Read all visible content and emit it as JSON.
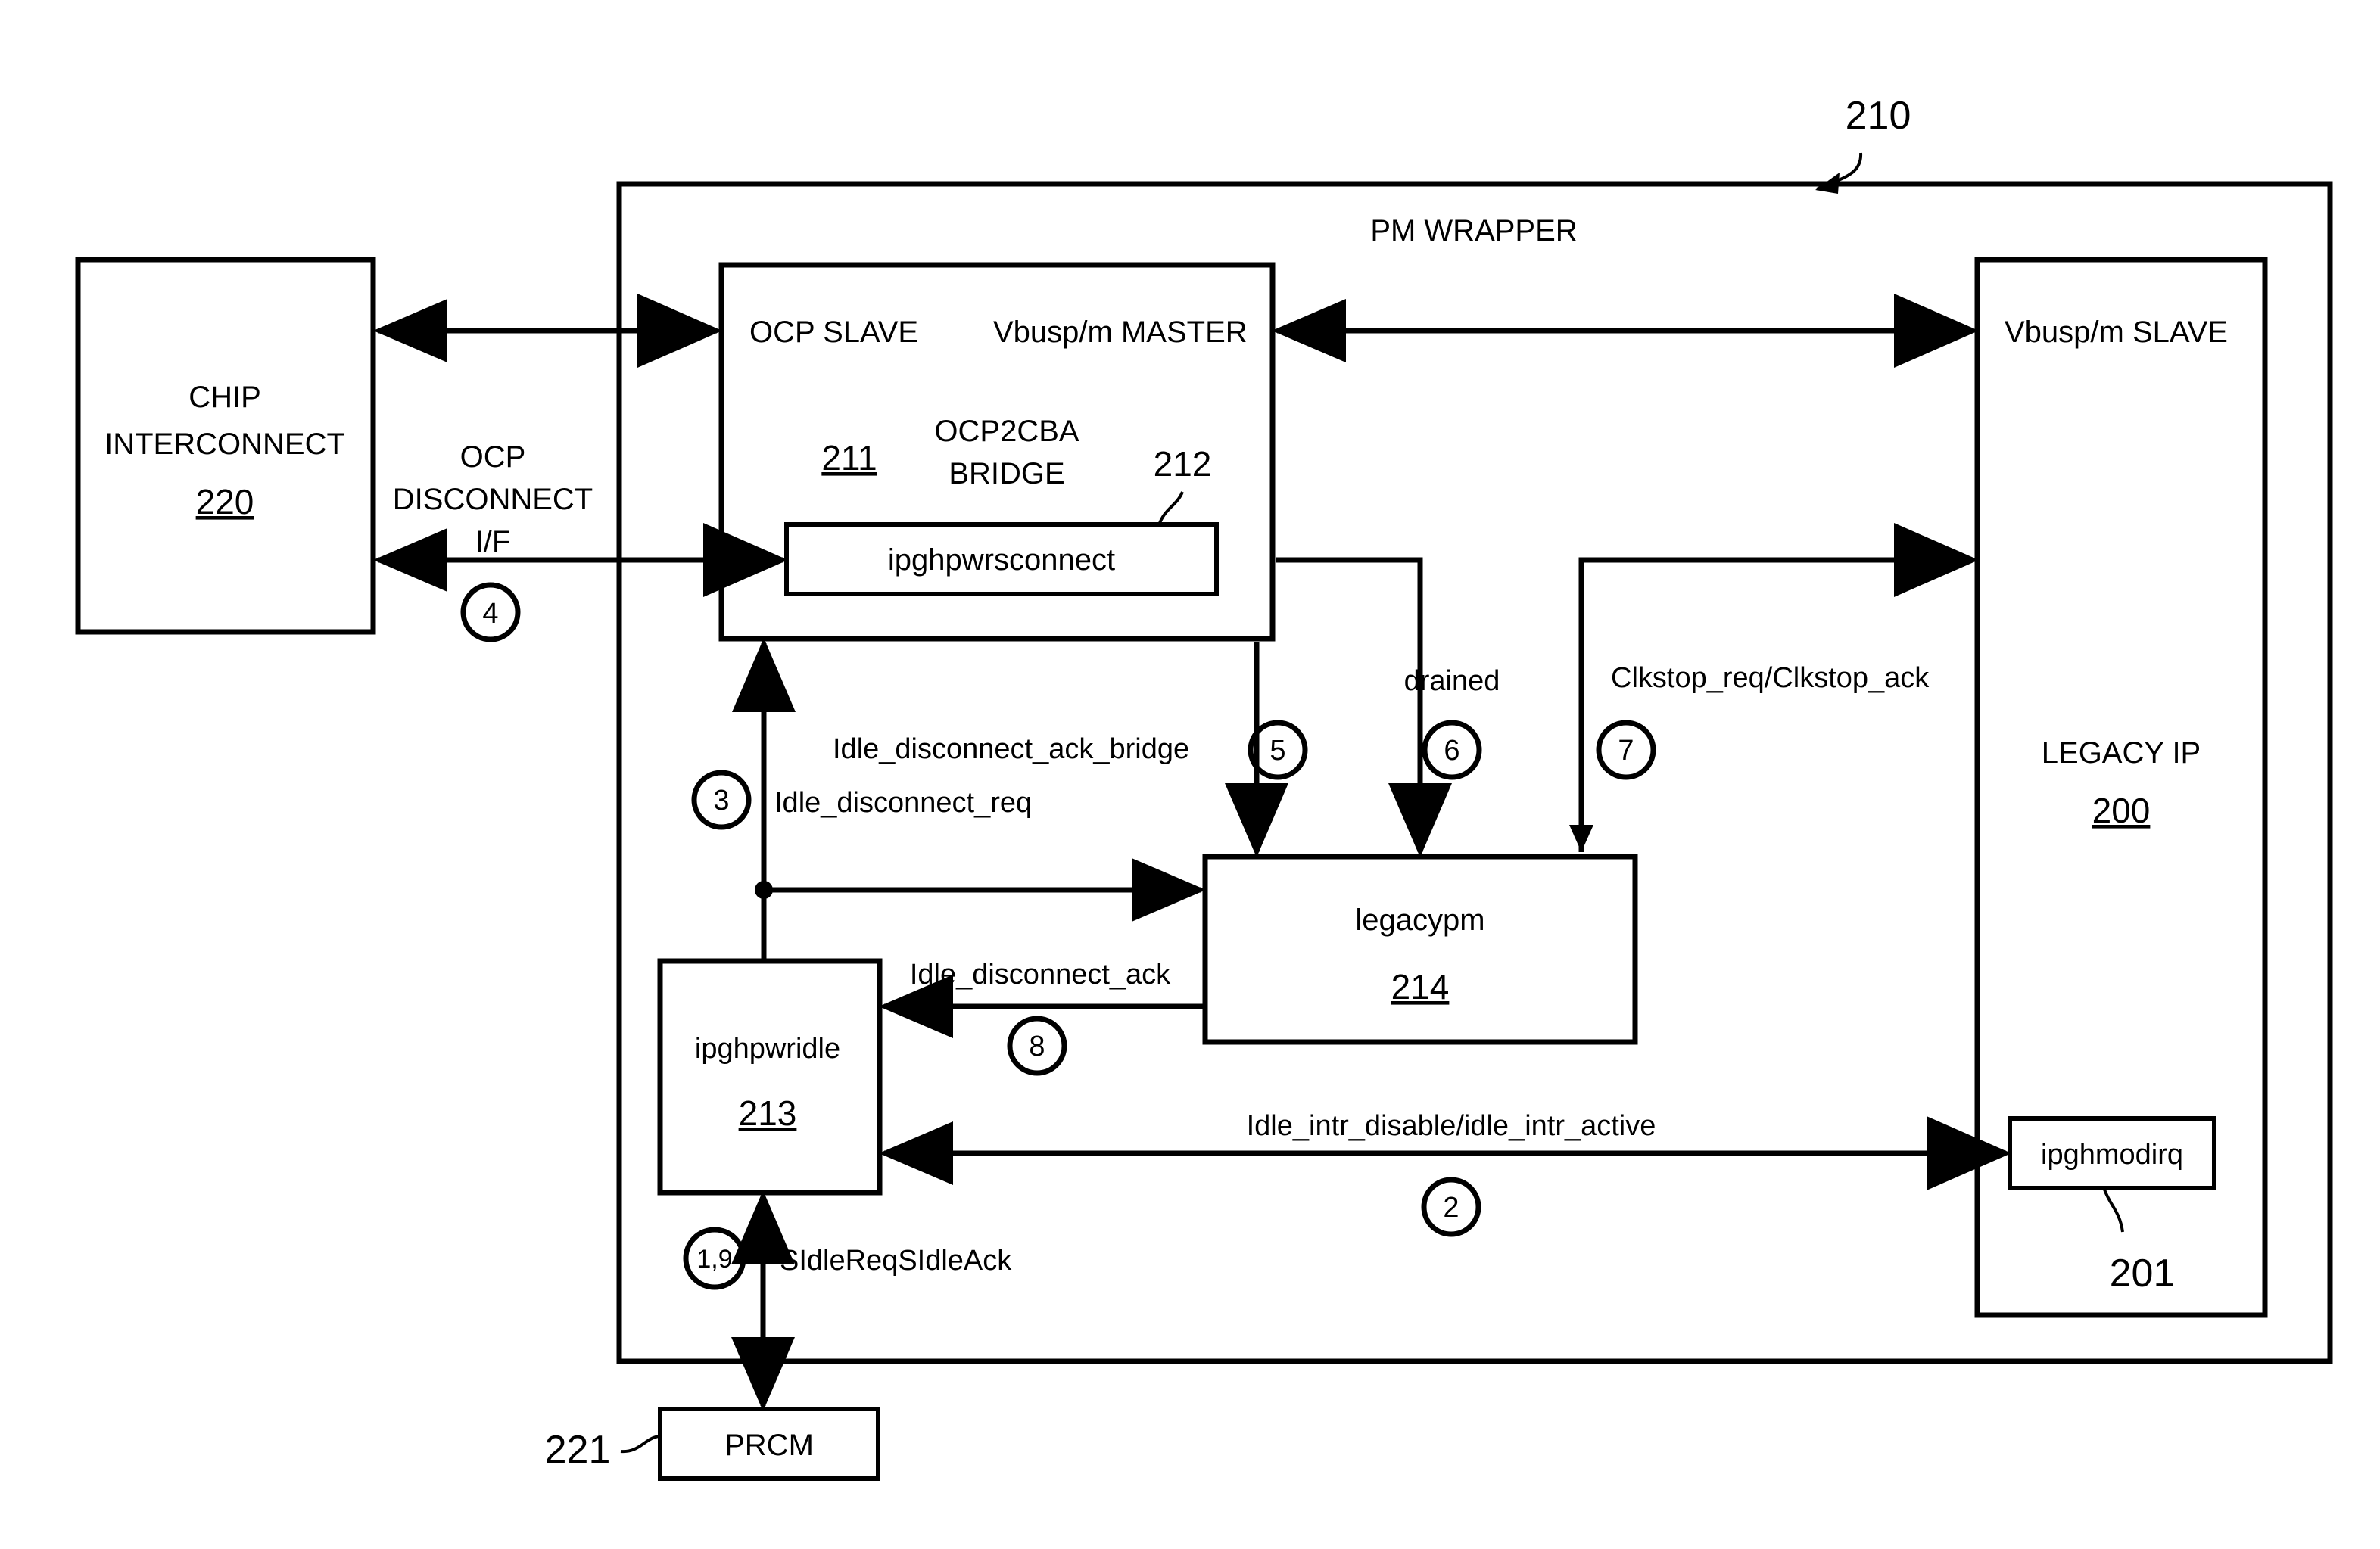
{
  "figure": {
    "title": "PM WRAPPER block diagram",
    "background": "#ffffff",
    "ink": "#000000"
  },
  "wrapper": {
    "label": "PM WRAPPER",
    "ref": "210"
  },
  "blocks": {
    "chip_interconnect": {
      "line1": "CHIP",
      "line2": "INTERCONNECT",
      "ref": "220"
    },
    "bridge": {
      "port_left": "OCP SLAVE",
      "port_right": "Vbusp/m MASTER",
      "name_line1": "OCP2CBA",
      "name_line2": "BRIDGE",
      "ref": "211",
      "inner_ref": "212",
      "inner_label": "ipghpwrsconnect"
    },
    "legacy_ip": {
      "port_left": "Vbusp/m SLAVE",
      "name": "LEGACY IP",
      "ref": "200"
    },
    "ipghmodirq": {
      "label": "ipghmodirq",
      "ref": "201"
    },
    "legacypm": {
      "label": "legacypm",
      "ref": "214"
    },
    "ipghpwridle": {
      "label": "ipghpwridle",
      "ref": "213"
    },
    "prcm": {
      "label": "PRCM",
      "ref": "221"
    }
  },
  "signals": {
    "ocp_disconnect_if": {
      "line1": "OCP",
      "line2": "DISCONNECT",
      "line3": "I/F",
      "marker": "4"
    },
    "idle_disconnect_ack_bridge": {
      "label": "Idle_disconnect_ack_bridge",
      "marker": "5"
    },
    "idle_disconnect_req": {
      "label": "Idle_disconnect_req",
      "marker": "3"
    },
    "drained": {
      "label": "drained",
      "marker": "6"
    },
    "clkstop": {
      "label": "Clkstop_req/Clkstop_ack",
      "marker": "7"
    },
    "idle_disconnect_ack": {
      "label": "Idle_disconnect_ack",
      "marker": "8"
    },
    "idle_intr": {
      "label": "Idle_intr_disable/idle_intr_active",
      "marker": "2"
    },
    "sidlereq": {
      "label": "SIdleReqSIdleAck",
      "marker": "1,9"
    }
  }
}
